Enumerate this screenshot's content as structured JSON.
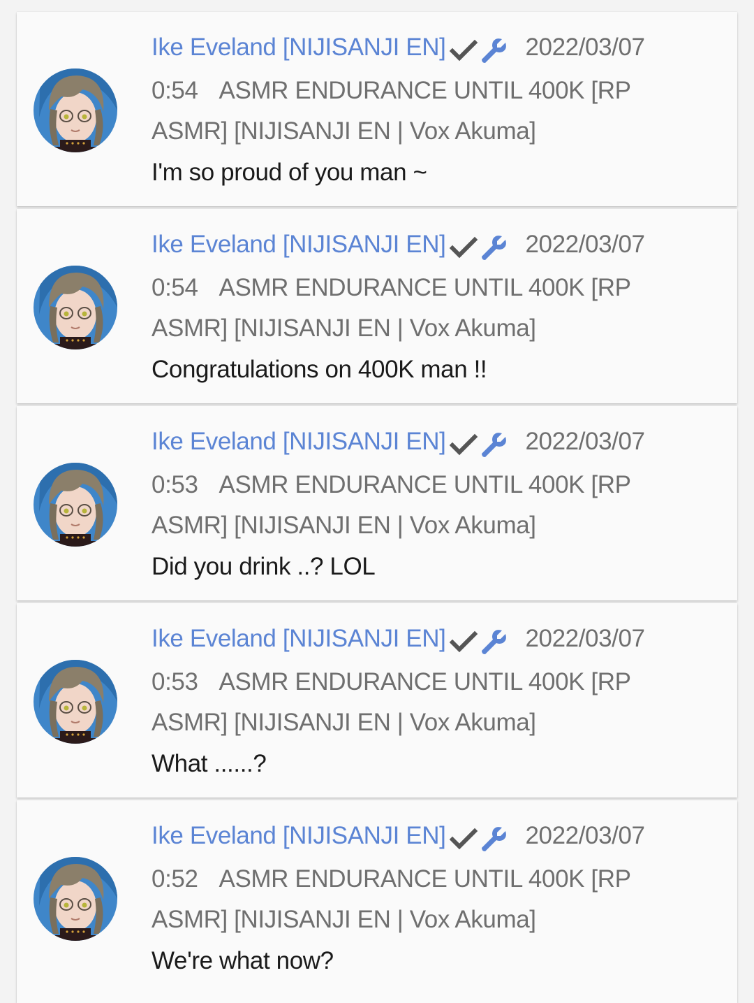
{
  "colors": {
    "author": "#5b84d4",
    "meta": "#6f6f6f",
    "message": "#1a1a1a",
    "badge_check": "#555555",
    "badge_wrench": "#5b84d4"
  },
  "icons": {
    "verified": "check-icon",
    "moderator": "wrench-icon"
  },
  "comments": [
    {
      "author": "Ike Eveland [NIJISANJI EN]",
      "date": "2022/03/07",
      "time": "0:54",
      "video_title": "ASMR ENDURANCE UNTIL 400K [RP ASMR] [NIJISANJI EN | Vox Akuma]",
      "message": "I'm so proud of you man ~"
    },
    {
      "author": "Ike Eveland [NIJISANJI EN]",
      "date": "2022/03/07",
      "time": "0:54",
      "video_title": "ASMR ENDURANCE UNTIL 400K [RP ASMR] [NIJISANJI EN | Vox Akuma]",
      "message": "Congratulations on 400K man !!"
    },
    {
      "author": "Ike Eveland [NIJISANJI EN]",
      "date": "2022/03/07",
      "time": "0:53",
      "video_title": "ASMR ENDURANCE UNTIL 400K [RP ASMR] [NIJISANJI EN | Vox Akuma]",
      "message": "Did you drink ..? LOL"
    },
    {
      "author": "Ike Eveland [NIJISANJI EN]",
      "date": "2022/03/07",
      "time": "0:53",
      "video_title": "ASMR ENDURANCE UNTIL 400K [RP ASMR] [NIJISANJI EN | Vox Akuma]",
      "message": "What ......?"
    },
    {
      "author": "Ike Eveland [NIJISANJI EN]",
      "date": "2022/03/07",
      "time": "0:52",
      "video_title": "ASMR ENDURANCE UNTIL 400K [RP ASMR] [NIJISANJI EN | Vox Akuma]",
      "message": "We're what now?"
    }
  ]
}
